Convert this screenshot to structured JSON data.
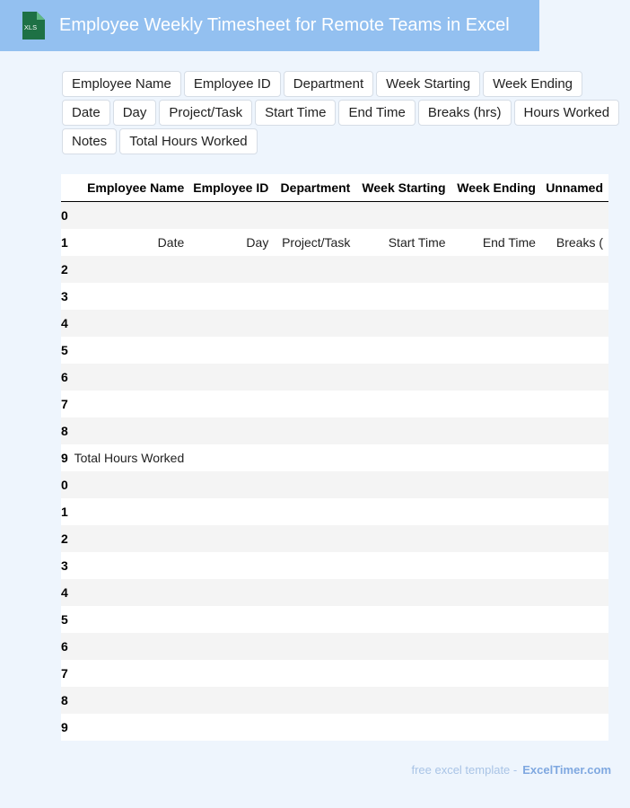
{
  "header": {
    "title": "Employee Weekly Timesheet for Remote Teams in Excel",
    "icon_label": "XLS",
    "icon_name": "excel-file-icon",
    "accent_color": "#93c0f0",
    "icon_color": "#1e7145"
  },
  "chips": [
    "Employee Name",
    "Employee ID",
    "Department",
    "Week Starting",
    "Week Ending",
    "Date",
    "Day",
    "Project/Task",
    "Start Time",
    "End Time",
    "Breaks (hrs)",
    "Hours Worked",
    "Notes",
    "Total Hours Worked"
  ],
  "table": {
    "columns": [
      "",
      "Employee Name",
      "Employee ID",
      "Department",
      "Week Starting",
      "Week Ending",
      "Unnamed"
    ],
    "rows": [
      {
        "index": "0",
        "cells": [
          "",
          "",
          "",
          "",
          "",
          ""
        ]
      },
      {
        "index": "1",
        "cells": [
          "Date",
          "Day",
          "Project/Task",
          "Start Time",
          "End Time",
          "Breaks ("
        ]
      },
      {
        "index": "2",
        "cells": [
          "",
          "",
          "",
          "",
          "",
          ""
        ]
      },
      {
        "index": "3",
        "cells": [
          "",
          "",
          "",
          "",
          "",
          ""
        ]
      },
      {
        "index": "4",
        "cells": [
          "",
          "",
          "",
          "",
          "",
          ""
        ]
      },
      {
        "index": "5",
        "cells": [
          "",
          "",
          "",
          "",
          "",
          ""
        ]
      },
      {
        "index": "6",
        "cells": [
          "",
          "",
          "",
          "",
          "",
          ""
        ]
      },
      {
        "index": "7",
        "cells": [
          "",
          "",
          "",
          "",
          "",
          ""
        ]
      },
      {
        "index": "8",
        "cells": [
          "",
          "",
          "",
          "",
          "",
          ""
        ]
      },
      {
        "index": "9",
        "cells": [
          "Total Hours Worked",
          "",
          "",
          "",
          "",
          ""
        ]
      },
      {
        "index": "0",
        "cells": [
          "",
          "",
          "",
          "",
          "",
          ""
        ]
      },
      {
        "index": "1",
        "cells": [
          "",
          "",
          "",
          "",
          "",
          ""
        ]
      },
      {
        "index": "2",
        "cells": [
          "",
          "",
          "",
          "",
          "",
          ""
        ]
      },
      {
        "index": "3",
        "cells": [
          "",
          "",
          "",
          "",
          "",
          ""
        ]
      },
      {
        "index": "4",
        "cells": [
          "",
          "",
          "",
          "",
          "",
          ""
        ]
      },
      {
        "index": "5",
        "cells": [
          "",
          "",
          "",
          "",
          "",
          ""
        ]
      },
      {
        "index": "6",
        "cells": [
          "",
          "",
          "",
          "",
          "",
          ""
        ]
      },
      {
        "index": "7",
        "cells": [
          "",
          "",
          "",
          "",
          "",
          ""
        ]
      },
      {
        "index": "8",
        "cells": [
          "",
          "",
          "",
          "",
          "",
          ""
        ]
      },
      {
        "index": "9",
        "cells": [
          "",
          "",
          "",
          "",
          "",
          ""
        ]
      }
    ]
  },
  "footer": {
    "text": "free excel template -",
    "brand": "ExcelTimer.com"
  }
}
